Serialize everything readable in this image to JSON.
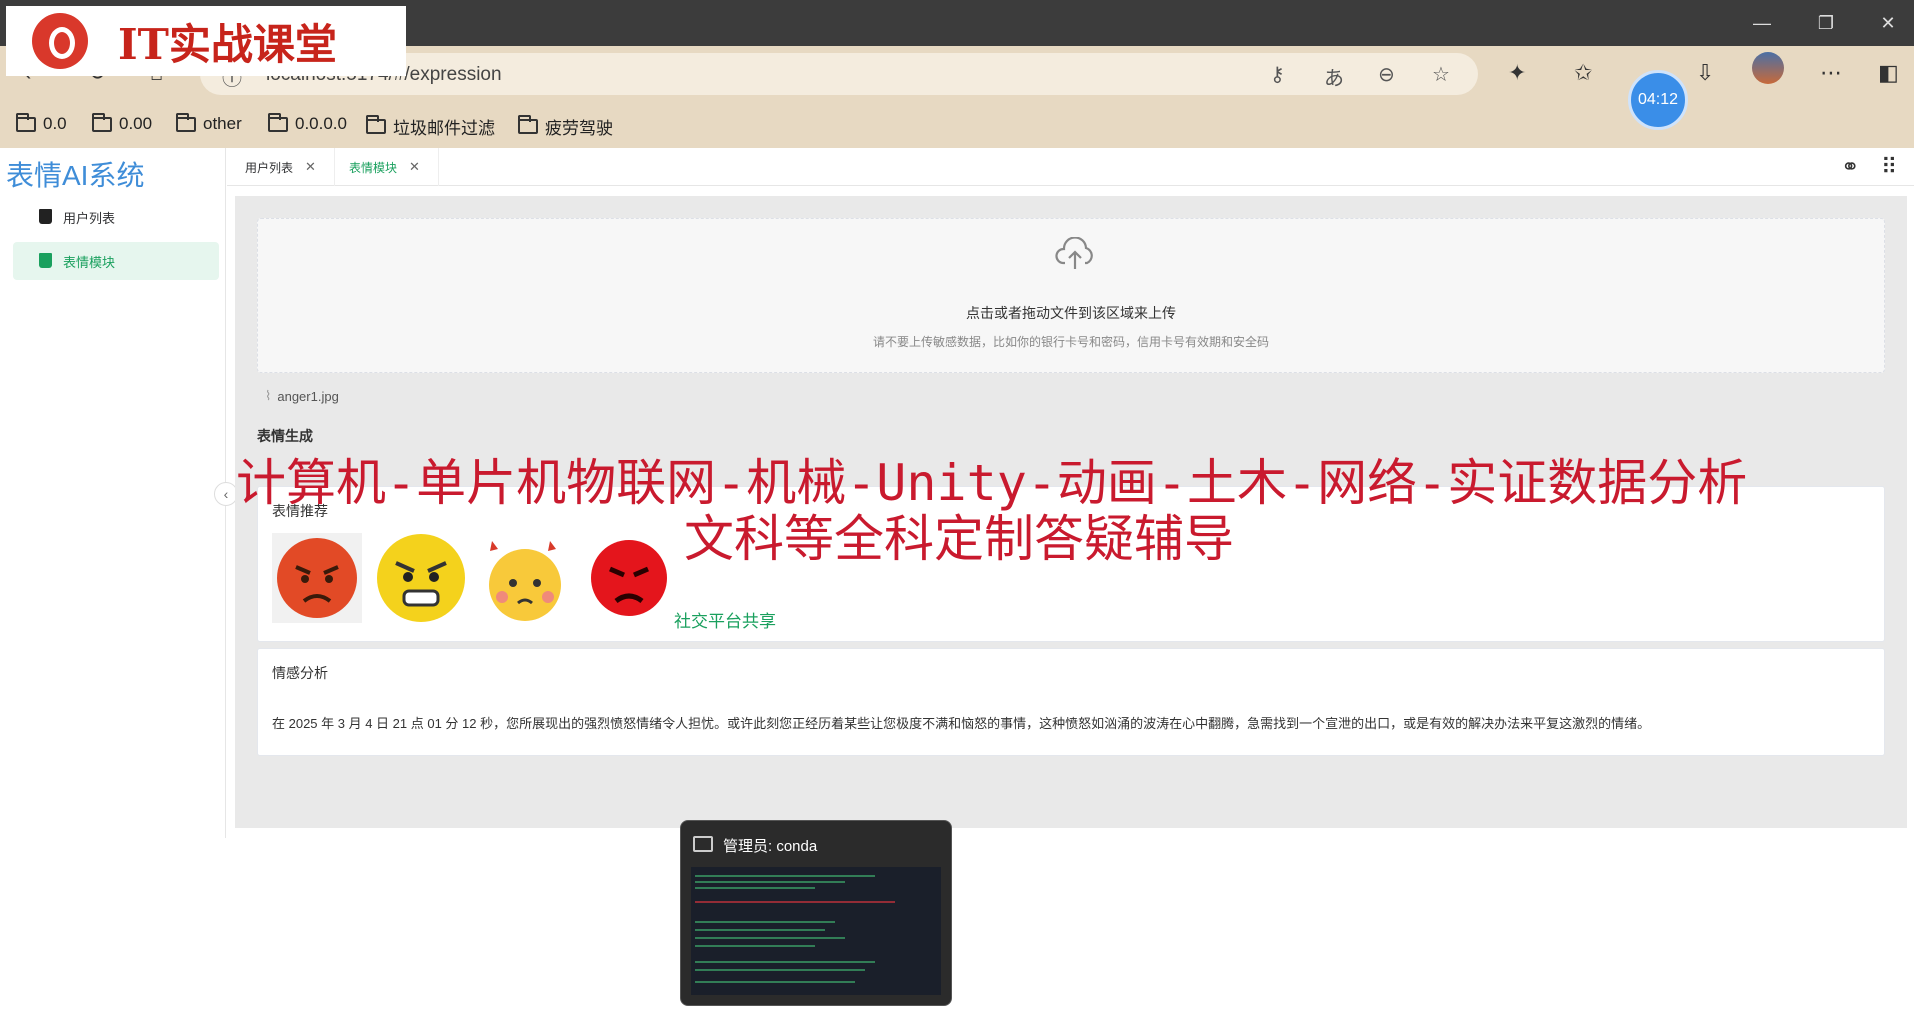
{
  "browser": {
    "url": "localhost:5174/#/expression",
    "bookmarks": [
      "0.0",
      "0.00",
      "other",
      "0.0.0.0",
      "垃圾邮件过滤",
      "疲劳驾驶"
    ],
    "timer": "04:12"
  },
  "logo": {
    "text": "IT实战课堂"
  },
  "app": {
    "brand": "表情AI系统",
    "menu": [
      {
        "label": "用户列表"
      },
      {
        "label": "表情模块"
      }
    ],
    "tabs": [
      {
        "label": "用户列表"
      },
      {
        "label": "表情模块"
      }
    ]
  },
  "upload": {
    "main": "点击或者拖动文件到该区域来上传",
    "hint": "请不要上传敏感数据，比如你的银行卡号和密码，信用卡号有效期和安全码",
    "file": "anger1.jpg"
  },
  "section_generate": "表情生成",
  "recommend": {
    "title": "表情推荐",
    "share": "社交平台共享"
  },
  "analysis": {
    "title": "情感分析",
    "text": "在 2025 年 3 月 4 日 21 点 01 分 12 秒，您所展现出的强烈愤怒情绪令人担忧。或许此刻您正经历着某些让您极度不满和恼怒的事情，这种愤怒如汹涌的波涛在心中翻腾，急需找到一个宣泄的出口，或是有效的解决办法来平复这激烈的情绪。"
  },
  "watermark": {
    "line1": "计算机-单片机物联网-机械-Unity-动画-土木-网络-实证数据分析",
    "line2": "文科等全科定制答疑辅导"
  },
  "taskbar_preview": {
    "title": "管理员: conda"
  }
}
